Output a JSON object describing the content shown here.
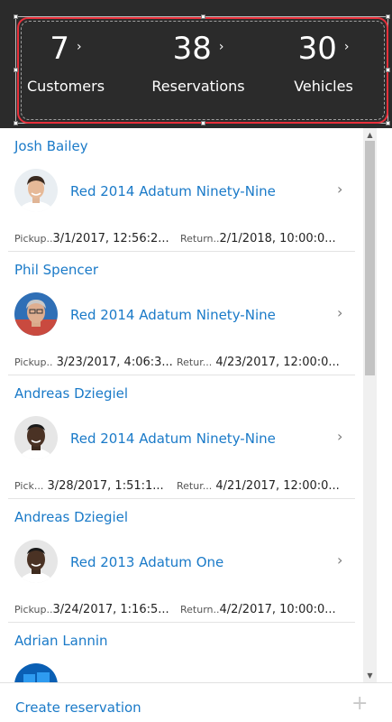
{
  "stats": [
    {
      "number": "7",
      "label": "Customers"
    },
    {
      "number": "38",
      "label": "Reservations"
    },
    {
      "number": "30",
      "label": "Vehicles"
    }
  ],
  "chevron": "›",
  "reservations": [
    {
      "customer": "Josh Bailey",
      "vehicle": "Red 2014 Adatum Ninety-Nine",
      "pickup_label": "Pickup..",
      "pickup": "3/1/2017, 12:56:2...",
      "return_label": "Return..",
      "return": "2/1/2018, 10:00:0...",
      "avatar": "person-light"
    },
    {
      "customer": "Phil Spencer",
      "vehicle": "Red 2014 Adatum Ninety-Nine",
      "pickup_label": "Pickup..",
      "pickup": "3/23/2017, 4:06:3...",
      "return_label": "Retur...",
      "return": "4/23/2017, 12:00:0...",
      "avatar": "person-gray"
    },
    {
      "customer": "Andreas Dziegiel",
      "vehicle": "Red 2014 Adatum Ninety-Nine",
      "pickup_label": "Pick...",
      "pickup": "3/28/2017, 1:51:1...",
      "return_label": "Retur...",
      "return": "4/21/2017, 12:00:0...",
      "avatar": "person-dark"
    },
    {
      "customer": "Andreas Dziegiel",
      "vehicle": "Red 2013 Adatum One",
      "pickup_label": "Pickup..",
      "pickup": "3/24/2017, 1:16:5...",
      "return_label": "Return..",
      "return": "4/2/2017, 10:00:0...",
      "avatar": "person-dark"
    },
    {
      "customer": "Adrian Lannin",
      "vehicle": "",
      "pickup_label": "",
      "pickup": "",
      "return_label": "",
      "return": "",
      "avatar": "windows-logo"
    }
  ],
  "footer": {
    "create_label": "Create reservation",
    "add_icon": "+"
  },
  "colors": {
    "header_bg": "#2b2b2b",
    "link_blue": "#1a7ac8",
    "selection_red": "#e8303b"
  }
}
